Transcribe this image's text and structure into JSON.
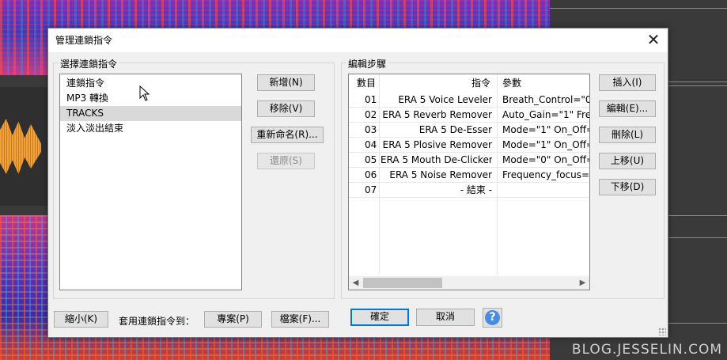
{
  "dialog": {
    "title": "管理連鎖指令",
    "close_glyph": "✕"
  },
  "left_group": {
    "label": "選擇連鎖指令",
    "list_header": "連鎖指令",
    "items": [
      {
        "label": "MP3 轉換"
      },
      {
        "label": "TRACKS"
      },
      {
        "label": "淡入淡出結束"
      }
    ],
    "selected": "TRACKS"
  },
  "middle_buttons": {
    "new": "新增(N)",
    "remove": "移除(V)",
    "rename": "重新命名(R)...",
    "restore": "還原(S)"
  },
  "right_group": {
    "label": "編輯步驟",
    "columns": [
      "數目",
      "指令",
      "參數"
    ],
    "rows": [
      {
        "num": "01",
        "command": "ERA 5 Voice Leveler",
        "params": "Breath_Control=\"0\""
      },
      {
        "num": "02",
        "command": "ERA 5 Reverb Remover",
        "params": "Auto_Gain=\"1\" Freq"
      },
      {
        "num": "03",
        "command": "ERA 5 De-Esser",
        "params": "Mode=\"1\" On_Off="
      },
      {
        "num": "04",
        "command": "ERA 5 Plosive Remover",
        "params": "Mode=\"1\" On_Off="
      },
      {
        "num": "05",
        "command": "ERA 5 Mouth De-Clicker",
        "params": "Mode=\"0\" On_Off="
      },
      {
        "num": "06",
        "command": "ERA 5 Noise Remover",
        "params": "Frequency_focus=\""
      },
      {
        "num": "07",
        "command": "- 結束 -",
        "params": ""
      }
    ]
  },
  "side_buttons": {
    "insert": "插入(I)",
    "edit": "編輯(E)...",
    "delete": "刪除(L)",
    "move_up": "上移(U)",
    "move_down": "下移(D)"
  },
  "bottom": {
    "minimize": "縮小(K)",
    "apply_label": "套用連鎖指令到：",
    "project": "專案(P)",
    "file": "檔案(F)...",
    "ok": "確定",
    "cancel": "取消",
    "help": "?"
  },
  "watermark": "BLOG.JESSELIN.COM",
  "colors": {
    "accent": "#0078d7",
    "selection": "#d9d9d9",
    "help_blue": "#4a8ce0"
  }
}
